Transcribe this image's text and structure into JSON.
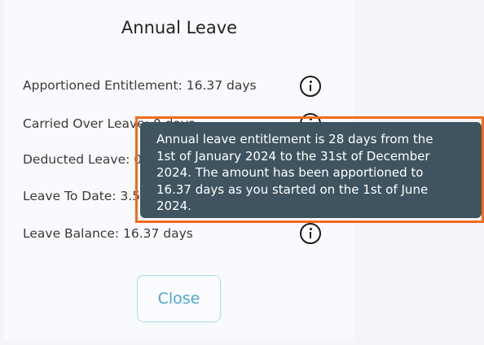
{
  "modal": {
    "title": "Annual Leave",
    "rows": [
      {
        "label": "Apportioned Entitlement: 16.37 days",
        "icon": "info-icon"
      },
      {
        "label": "Carried Over Leave: 0 days",
        "icon": "info-icon"
      },
      {
        "label": "Deducted Leave: 0 days",
        "icon": "info-icon"
      },
      {
        "label": "Leave To Date: 3.5 days",
        "icon": "info-icon"
      },
      {
        "label": "Leave Balance: 16.37 days",
        "icon": "info-icon"
      }
    ],
    "close_label": "Close"
  },
  "tooltip": {
    "lines": [
      "Annual leave entitlement is 28 days from the",
      "1st of January 2024 to the 31st of December",
      "2024. The amount has been apportioned to",
      "16.37 days as you started on the 1st of June",
      "2024."
    ]
  },
  "colors": {
    "highlight": "#f26a1b",
    "tooltip_bg": "#3f5460",
    "close_text": "#4ba6cf"
  }
}
